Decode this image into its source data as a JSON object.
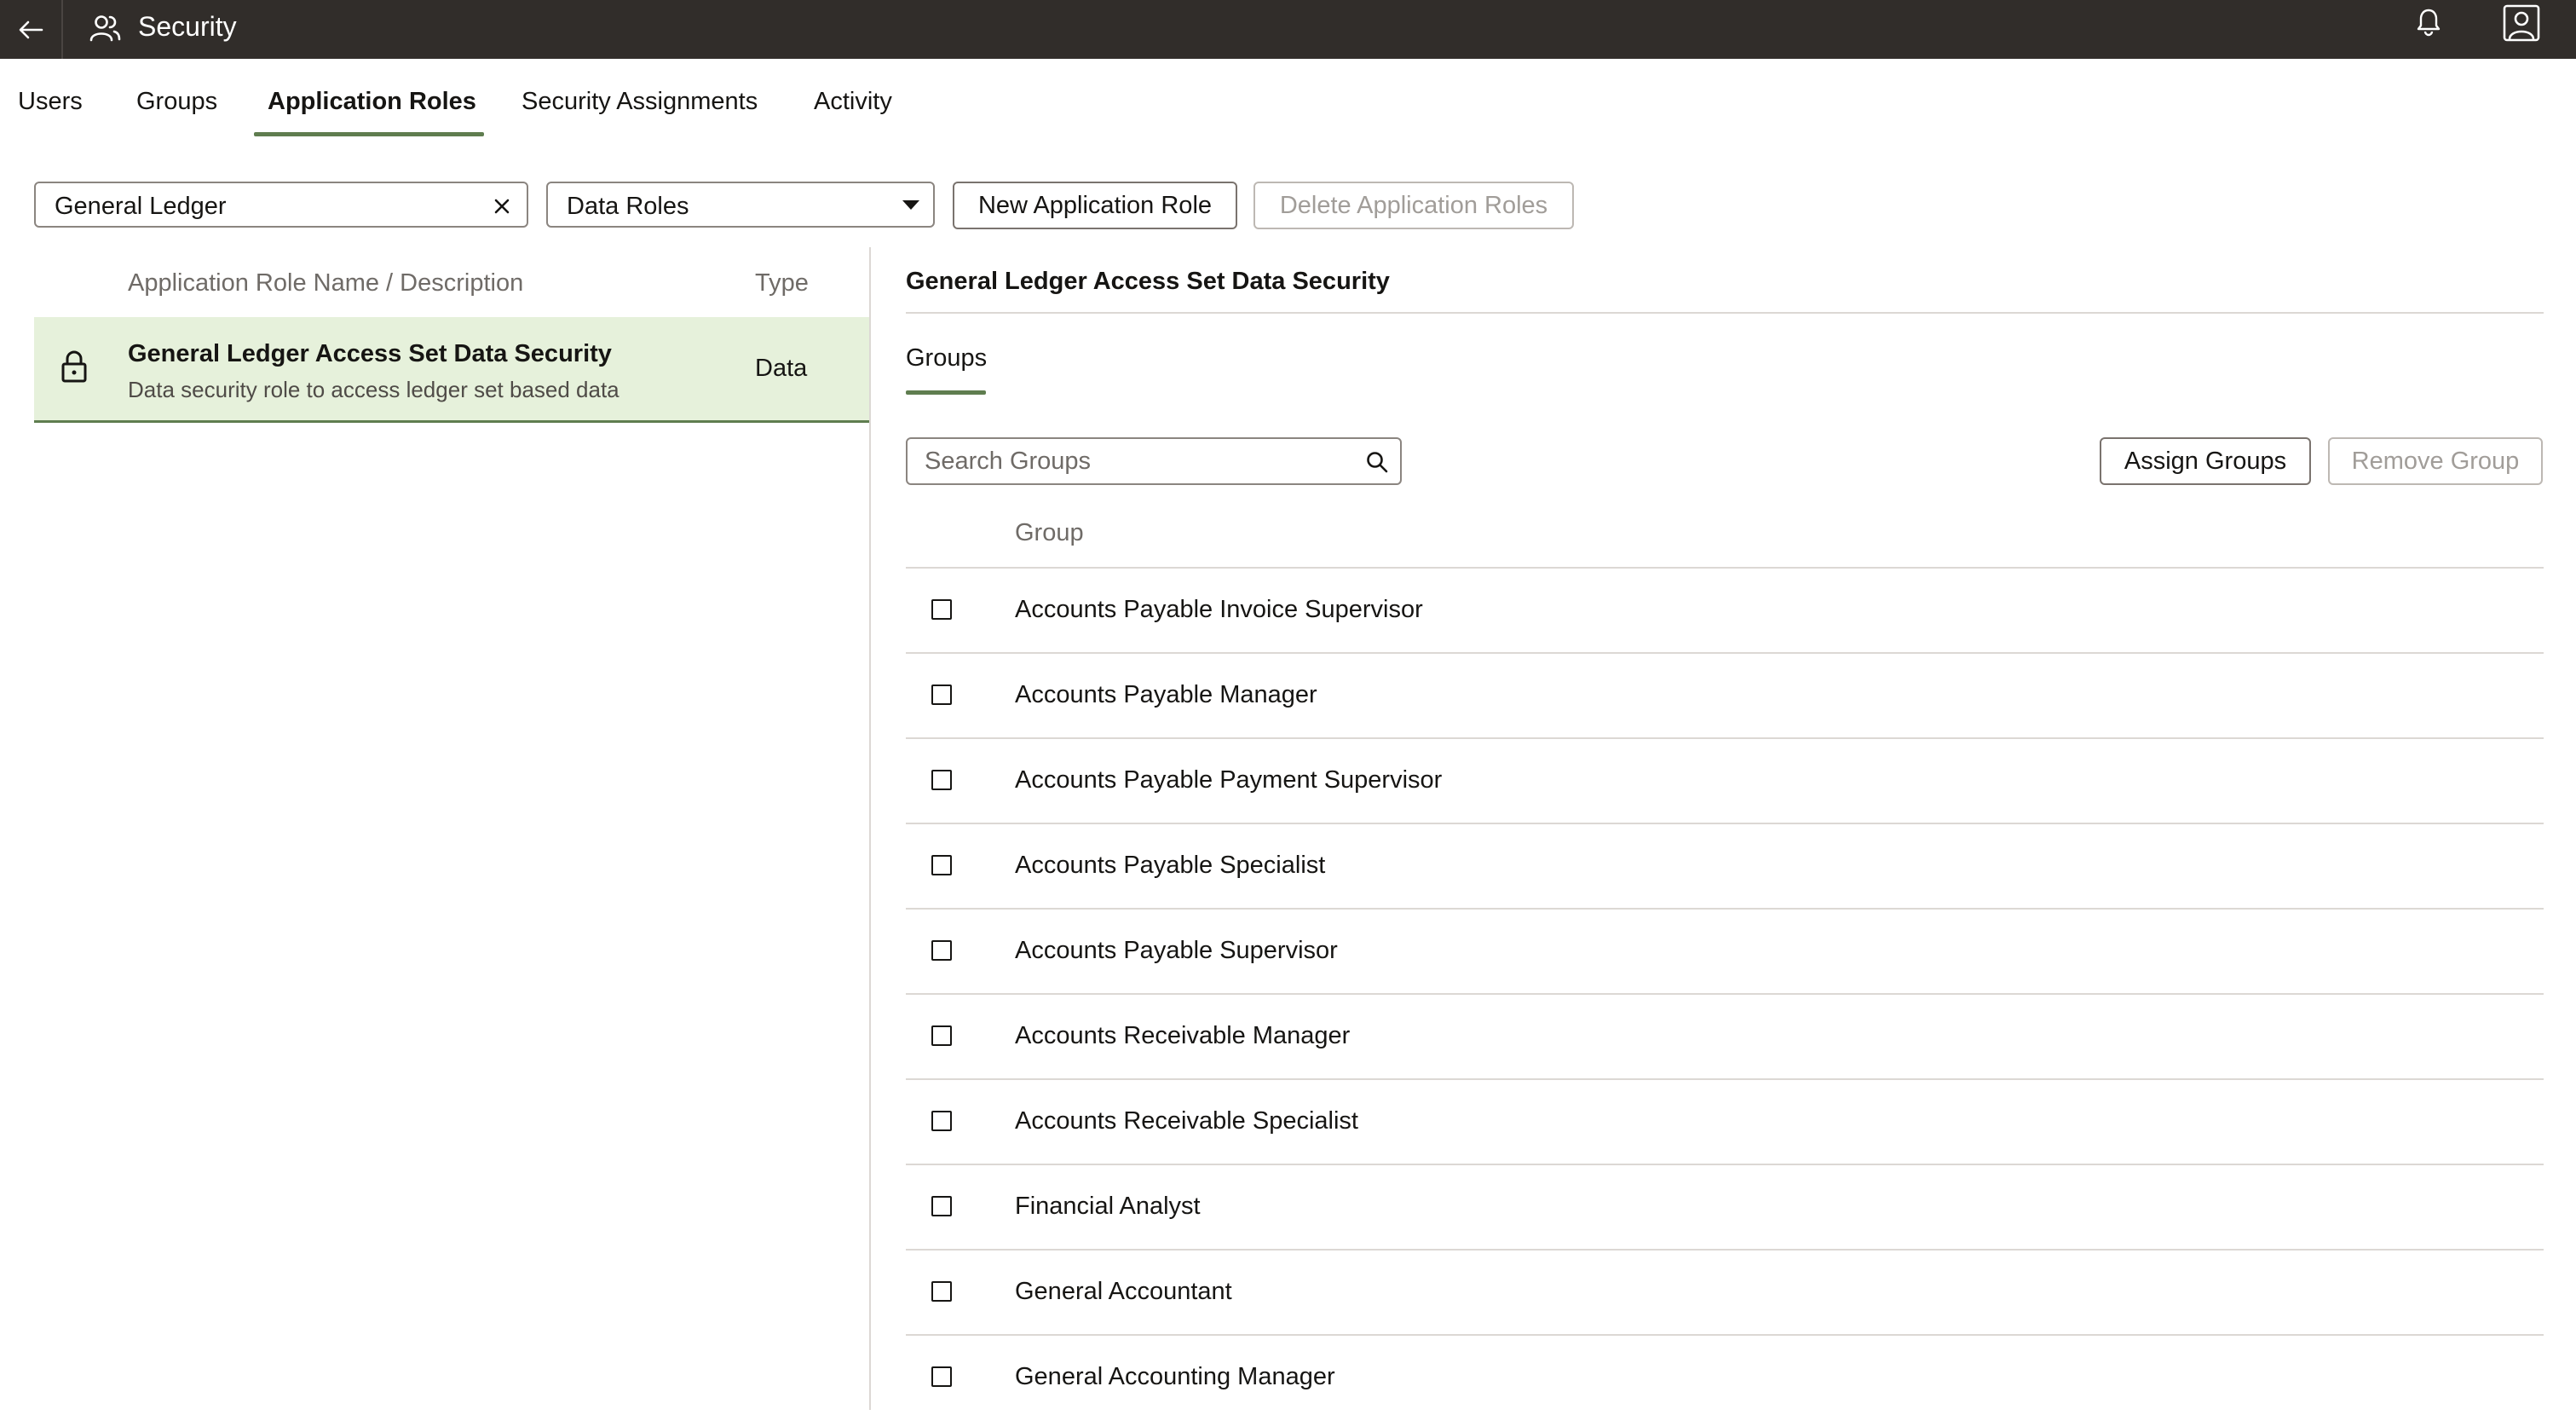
{
  "header": {
    "title": "Security"
  },
  "tabs": [
    {
      "label": "Users"
    },
    {
      "label": "Groups"
    },
    {
      "label": "Application Roles"
    },
    {
      "label": "Security Assignments"
    },
    {
      "label": "Activity"
    }
  ],
  "active_tab": "Application Roles",
  "filter": {
    "search_value": "General Ledger",
    "role_type_selected": "Data Roles"
  },
  "toolbar": {
    "new_label": "New Application Role",
    "delete_label": "Delete Application Roles"
  },
  "role_list": {
    "header_name": "Application Role Name / Description",
    "header_type": "Type",
    "rows": [
      {
        "name": "General Ledger Access Set Data Security",
        "description": "Data security role to access ledger set based data",
        "type": "Data"
      }
    ]
  },
  "detail": {
    "title": "General Ledger Access Set Data Security",
    "subtab": "Groups",
    "search_placeholder": "Search Groups",
    "assign_label": "Assign Groups",
    "remove_label": "Remove Group",
    "column_header": "Group",
    "groups": [
      "Accounts Payable Invoice Supervisor",
      "Accounts Payable Manager",
      "Accounts Payable Payment Supervisor",
      "Accounts Payable Specialist",
      "Accounts Payable Supervisor",
      "Accounts Receivable Manager",
      "Accounts Receivable Specialist",
      "Financial Analyst",
      "General Accountant",
      "General Accounting Manager"
    ]
  },
  "colors": {
    "header_bg": "#312d2a",
    "accent": "#5f7d4f",
    "selected_row_bg": "#e6f1db"
  }
}
